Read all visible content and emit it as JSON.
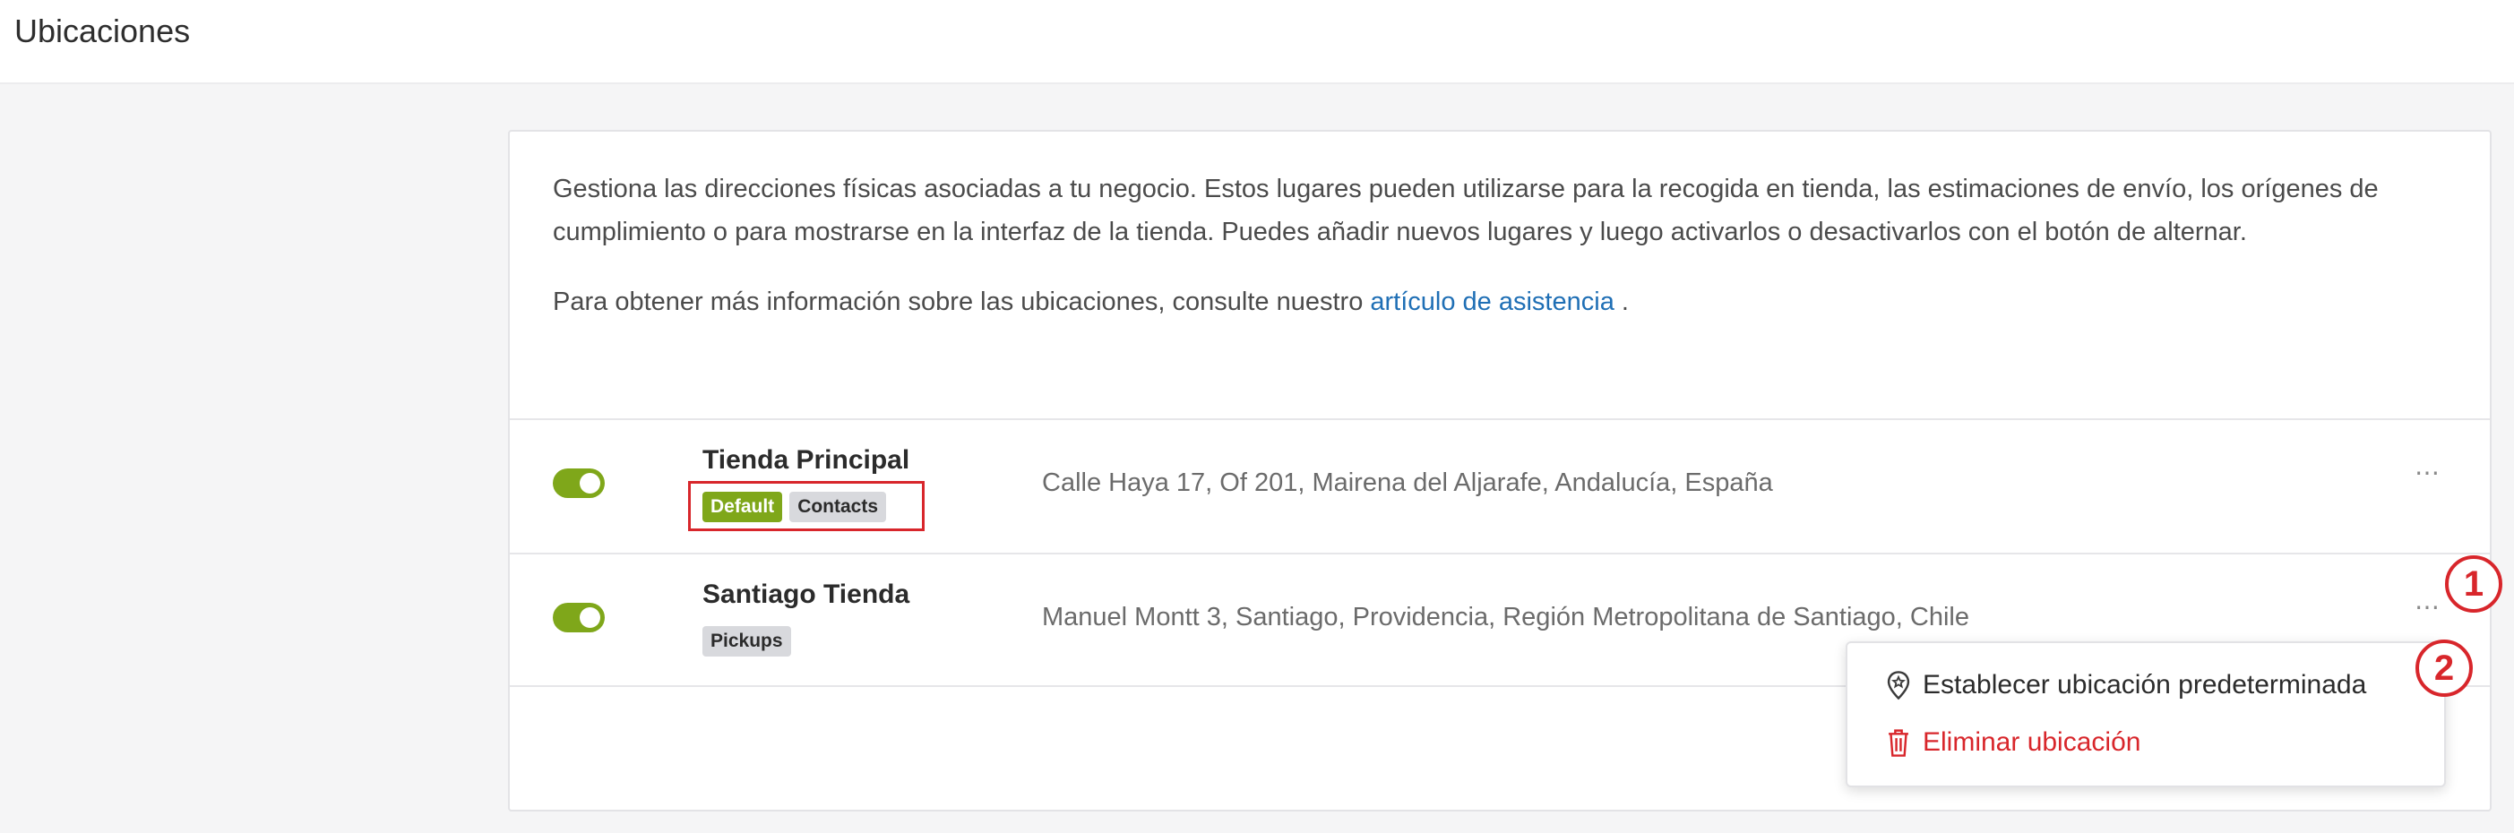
{
  "header": {
    "title": "Ubicaciones"
  },
  "intro": {
    "paragraph1": "Gestiona las direcciones físicas asociadas a tu negocio. Estos lugares pueden utilizarse para la recogida en tienda, las estimaciones de envío, los orígenes de cumplimiento o para mostrarse en la interfaz de la tienda. Puedes añadir nuevos lugares y luego activarlos o desactivarlos con el botón de alternar.",
    "paragraph2_prefix": "Para obtener más información sobre las ubicaciones, consulte nuestro ",
    "help_link": "artículo de asistencia",
    "paragraph2_suffix": " ."
  },
  "locations": [
    {
      "name": "Tienda Principal",
      "badges": [
        "Default",
        "Contacts"
      ],
      "address": "Calle Haya 17, Of 201, Mairena del Aljarafe, Andalucía, España",
      "enabled": true,
      "more_icon": "⋯"
    },
    {
      "name": "Santiago Tienda",
      "badges": [
        "Pickups"
      ],
      "address": "Manuel Montt 3, Santiago, Providencia, Región Metropolitana de Santiago, Chile",
      "enabled": true,
      "more_icon": "⋯"
    }
  ],
  "context_menu": {
    "set_default": "Establecer ubicación predeterminada",
    "delete": "Eliminar ubicación"
  },
  "callouts": [
    "1",
    "2"
  ],
  "colors": {
    "accent_green": "#7fa71a",
    "danger_red": "#d8262b",
    "link_blue": "#1f6fb5"
  }
}
